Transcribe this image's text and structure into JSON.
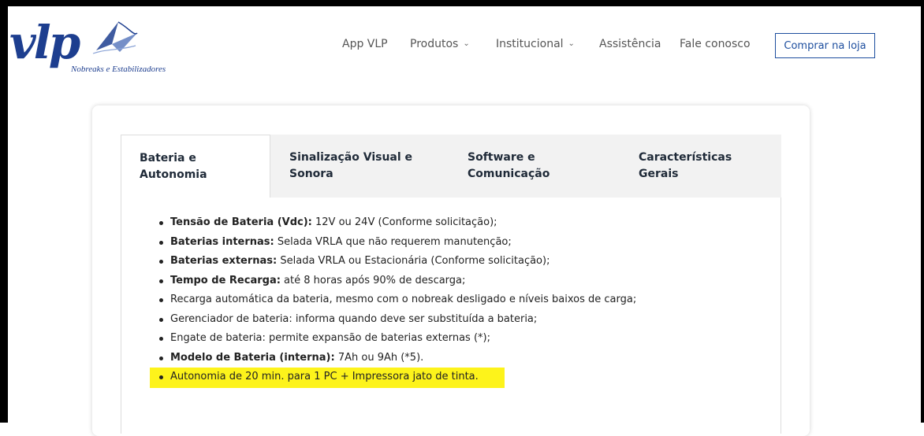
{
  "brand": {
    "logo_text": "vlp",
    "tagline": "Nobreaks e Estabilizadores",
    "color": "#1d3e8f"
  },
  "nav": {
    "items": [
      {
        "label": "App VLP",
        "has_dropdown": false
      },
      {
        "label": "Produtos",
        "has_dropdown": true
      },
      {
        "label": "Institucional",
        "has_dropdown": true
      },
      {
        "label": "Assistência",
        "has_dropdown": false
      },
      {
        "label": "Fale conosco",
        "has_dropdown": false
      }
    ],
    "cta_label": "Comprar na loja",
    "cta_color": "#1d4e9e"
  },
  "tabs": [
    {
      "label_line1": "Bateria e",
      "label_line2": "Autonomia",
      "active": true
    },
    {
      "label_line1": "Sinalização Visual e",
      "label_line2": "Sonora",
      "active": false
    },
    {
      "label_line1": "Software e",
      "label_line2": "Comunicação",
      "active": false
    },
    {
      "label_line1": "Características",
      "label_line2": "Gerais",
      "active": false
    }
  ],
  "specs": [
    {
      "bold": "Tensão de Bateria (Vdc):",
      "text": " 12V ou 24V (Conforme solicitação);"
    },
    {
      "bold": "Baterias internas:",
      "text": " Selada VRLA que não requerem manutenção;"
    },
    {
      "bold": "Baterias externas:",
      "text": " Selada VRLA ou Estacionária (Conforme solicitação);"
    },
    {
      "bold": "Tempo de Recarga:",
      "text": " até 8 horas após 90% de descarga;"
    },
    {
      "bold": "",
      "text": "Recarga automática da bateria, mesmo com o nobreak desligado e níveis baixos de carga;"
    },
    {
      "bold": "",
      "text": "Gerenciador de bateria: informa quando deve ser substituída a bateria;"
    },
    {
      "bold": "",
      "text": "Engate de bateria: permite expansão de baterias externas (*);"
    },
    {
      "bold": "Modelo de Bateria (interna):",
      "text": " 7Ah ou 9Ah (*5)."
    },
    {
      "bold": "",
      "text": "Autonomia de 20 min. para 1 PC + Impressora jato de tinta."
    }
  ],
  "highlight_color": "#fdf31b",
  "chevron_icon": "chevron-down-icon"
}
